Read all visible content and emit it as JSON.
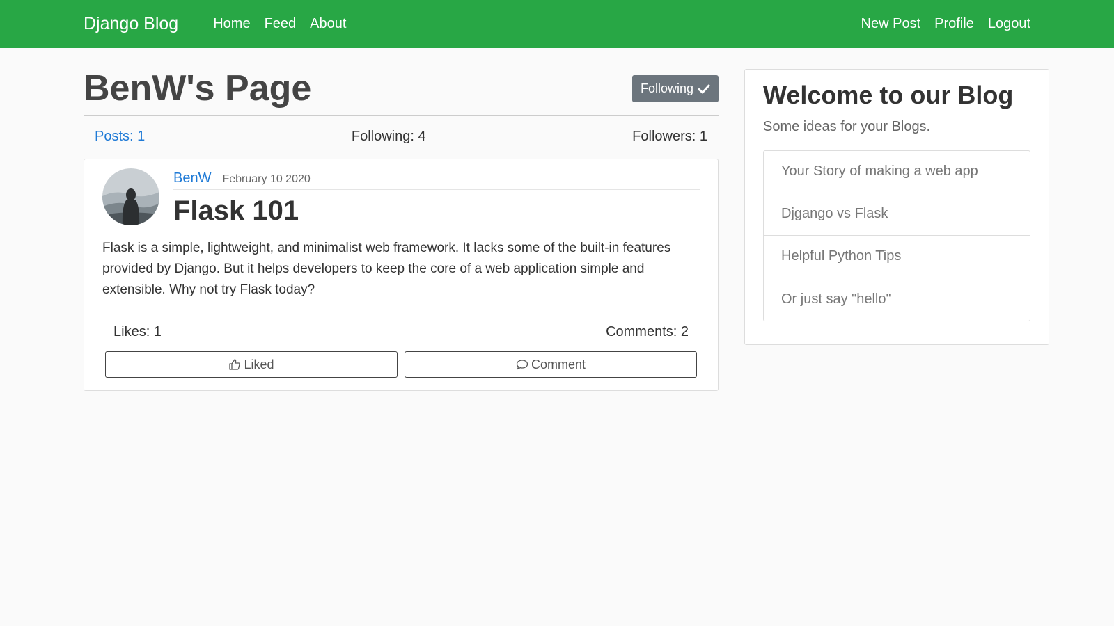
{
  "navbar": {
    "brand": "Django Blog",
    "left_links": [
      "Home",
      "Feed",
      "About"
    ],
    "right_links": [
      "New Post",
      "Profile",
      "Logout"
    ],
    "color": "#28a745"
  },
  "profile": {
    "title": "BenW's Page",
    "follow_button": "Following",
    "follow_icon": "check-icon",
    "stats": {
      "posts": "Posts: 1",
      "following": "Following: 4",
      "followers": "Followers: 1"
    }
  },
  "post": {
    "author": "BenW",
    "date": "February 10 2020",
    "title": "Flask 101",
    "body": "Flask is a simple, lightweight, and minimalist web framework. It lacks some of the built-in features provided by Django. But it helps developers to keep the core of a web application simple and extensible. Why not try Flask today?",
    "likes": "Likes: 1",
    "comments": "Comments: 2",
    "like_button": "Liked",
    "comment_button": "Comment"
  },
  "sidebar": {
    "title": "Welcome to our Blog",
    "subtitle": "Some ideas for your Blogs.",
    "items": [
      {
        "label": "Your Story of making a web app"
      },
      {
        "label": "Djgango vs Flask"
      },
      {
        "label": "Helpful Python Tips"
      },
      {
        "label": "Or just say \"hello\""
      }
    ]
  }
}
